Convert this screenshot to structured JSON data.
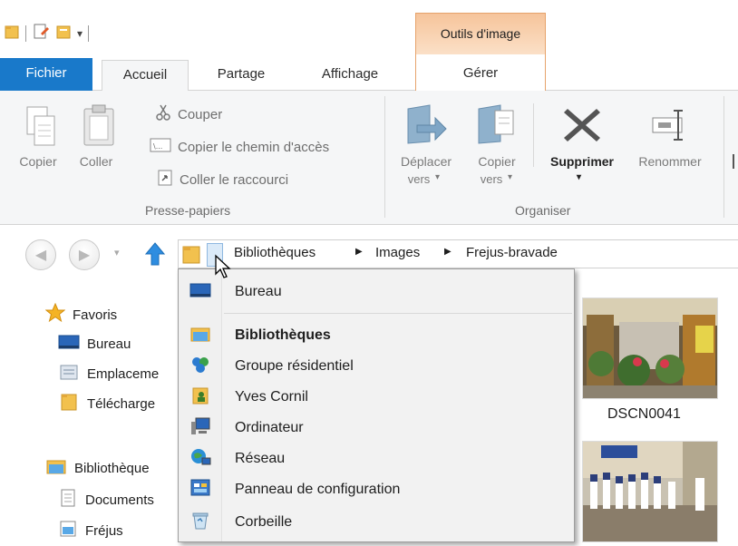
{
  "contextual_tab": {
    "header": "Outils d'image",
    "tab": "Gérer"
  },
  "tabs": {
    "file": "Fichier",
    "home": "Accueil",
    "share": "Partage",
    "view": "Affichage"
  },
  "ribbon": {
    "clipboard": {
      "copy": "Copier",
      "paste": "Coller",
      "cut": "Couper",
      "copy_path": "Copier le chemin d'accès",
      "paste_shortcut": "Coller le raccourci",
      "group_label": "Presse-papiers"
    },
    "organize": {
      "move_to_l1": "Déplacer",
      "move_to_l2": "vers",
      "copy_to_l1": "Copier",
      "copy_to_l2": "vers",
      "delete": "Supprimer",
      "rename": "Renommer",
      "group_label": "Organiser"
    }
  },
  "address": {
    "crumbs": [
      "Bibliothèques",
      "Images",
      "Frejus-bravade"
    ]
  },
  "nav": {
    "favorites": "Favoris",
    "desktop": "Bureau",
    "places": "Emplaceme",
    "downloads": "Télécharge",
    "libraries": "Bibliothèque",
    "documents": "Documents",
    "frejus": "Fréjus"
  },
  "content": {
    "thumb1_caption": "DSCN0041"
  },
  "dropdown": {
    "items": [
      "Bureau",
      "Bibliothèques",
      "Groupe résidentiel",
      "Yves Cornil",
      "Ordinateur",
      "Réseau",
      "Panneau de configuration",
      "Corbeille"
    ]
  },
  "colors": {
    "file_tab": "#1979ca",
    "contextual": "#f6c49b",
    "folder": "#f2c14e"
  }
}
